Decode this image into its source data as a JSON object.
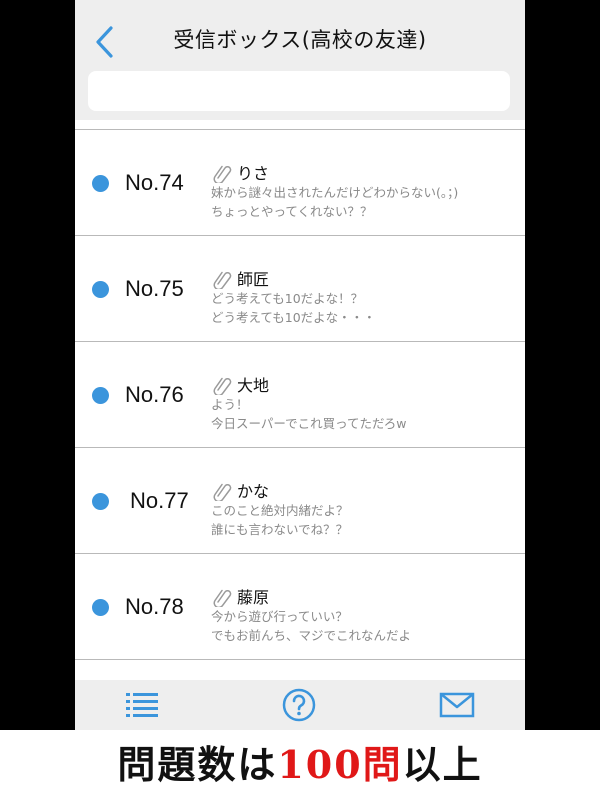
{
  "header": {
    "title": "受信ボックス(高校の友達)"
  },
  "search": {
    "value": ""
  },
  "messages": [
    {
      "number": "No.74",
      "sender": "りさ",
      "line1": "妹から謎々出されたんだけどわからない(。；)",
      "line2": "ちょっとやってくれない？？"
    },
    {
      "number": "No.75",
      "sender": "師匠",
      "line1": "どう考えても10だよな！？",
      "line2": "どう考えても10だよな・・・"
    },
    {
      "number": "No.76",
      "sender": "大地",
      "line1": "よう！",
      "line2": "今日スーパーでこれ買ってただろw"
    },
    {
      "number": "No.77",
      "sender": "かな",
      "line1": "このこと絶対内緒だよ？",
      "line2": "誰にも言わないでね？？"
    },
    {
      "number": "No.78",
      "sender": "藤原",
      "line1": "今から遊び行っていい？",
      "line2": "でもお前んち、マジでこれなんだよ"
    }
  ],
  "tabbar": {
    "icons": [
      "list-icon",
      "help-icon",
      "mail-icon"
    ]
  },
  "caption": {
    "prefix": "問題数は",
    "highlight": "100問",
    "suffix": "以上"
  },
  "colors": {
    "accent": "#3b95dc",
    "unread_dot": "#3b95dc",
    "caption_red": "#e01818"
  }
}
